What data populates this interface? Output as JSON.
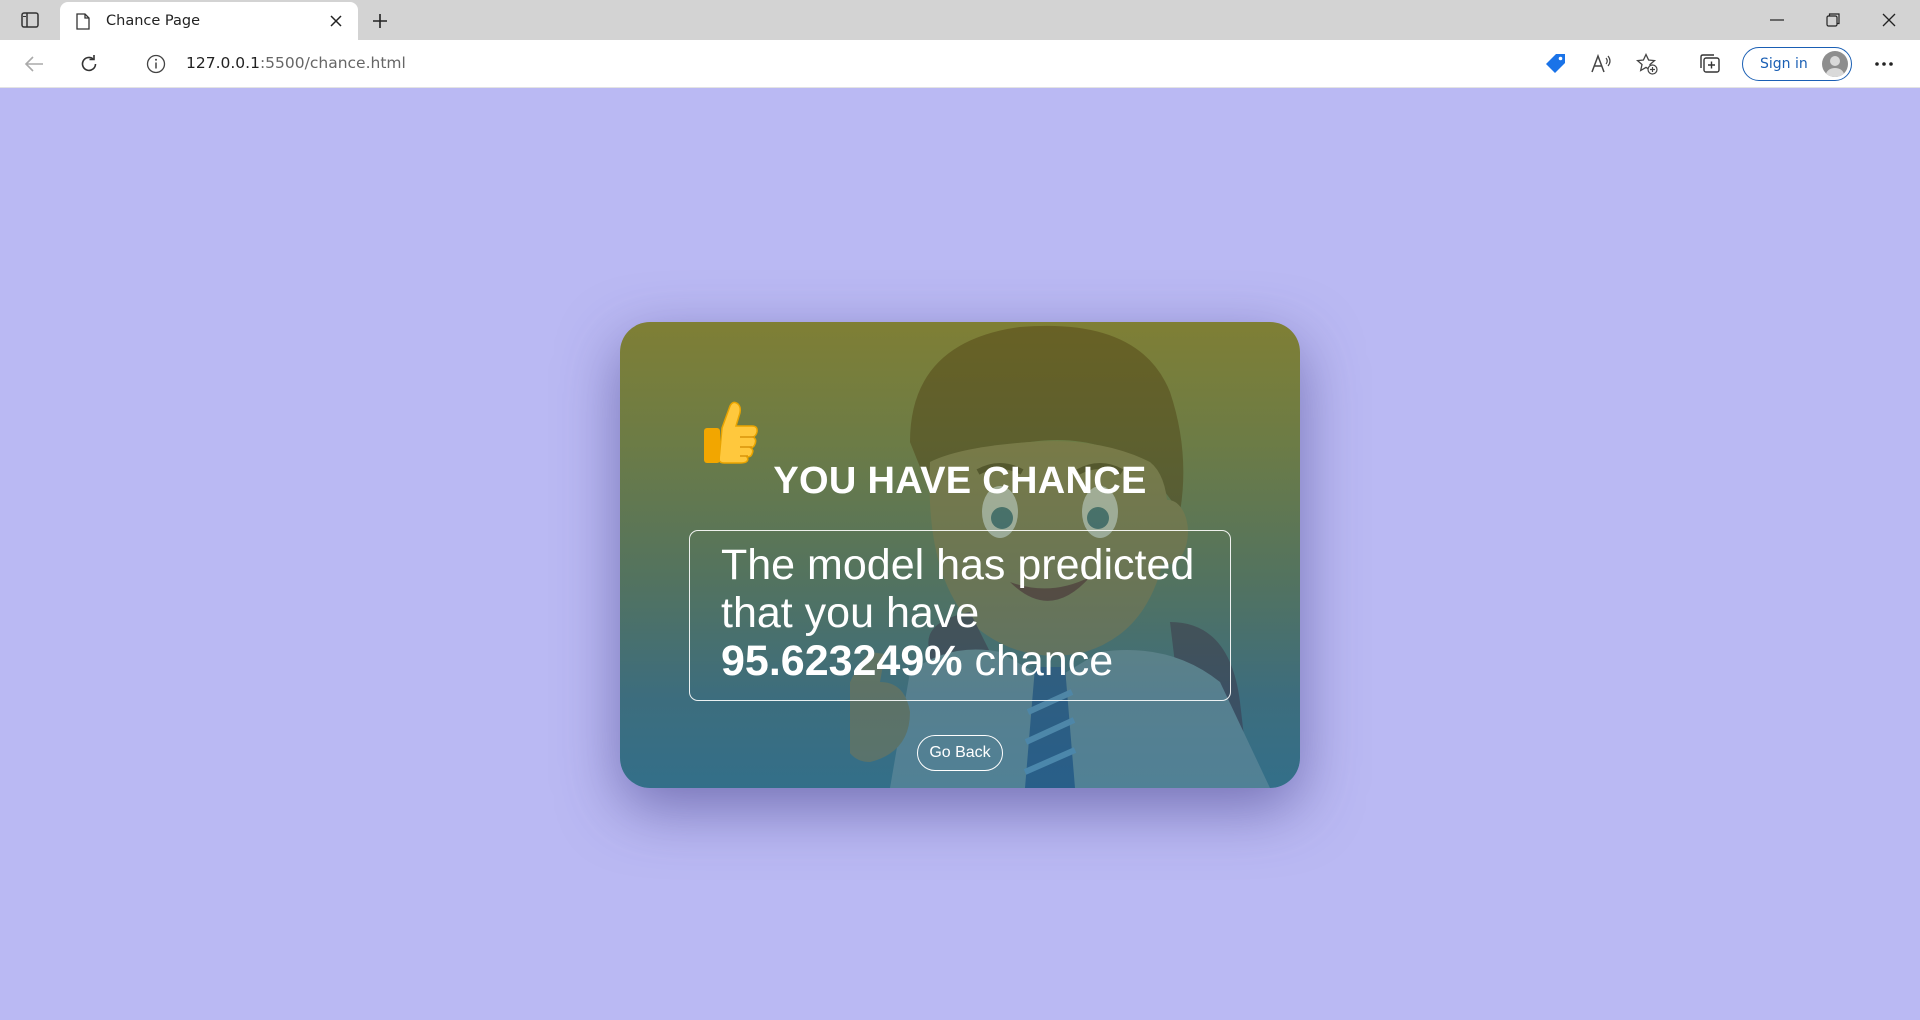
{
  "browser": {
    "tab_title": "Chance Page",
    "url_host": "127.0.0.1",
    "url_rest": ":5500/chance.html",
    "sign_in_label": "Sign in",
    "icons": [
      "sidebar-icon",
      "page-icon",
      "close-icon",
      "plus-icon",
      "minimize-icon",
      "restore-icon",
      "close-window-icon",
      "back-icon",
      "refresh-icon",
      "info-icon",
      "tag-icon",
      "read-aloud-icon",
      "favorite-icon",
      "collections-icon",
      "avatar-icon",
      "more-icon"
    ]
  },
  "page": {
    "background": "#bab9f3",
    "thumbs_icon": "thumbs-up-icon",
    "heading": "YOU HAVE CHANCE",
    "message_line1": "The model has predicted",
    "message_line2": "that you have",
    "chance_value": "95.623249%",
    "chance_word": "chance",
    "go_back_label": "Go Back"
  }
}
